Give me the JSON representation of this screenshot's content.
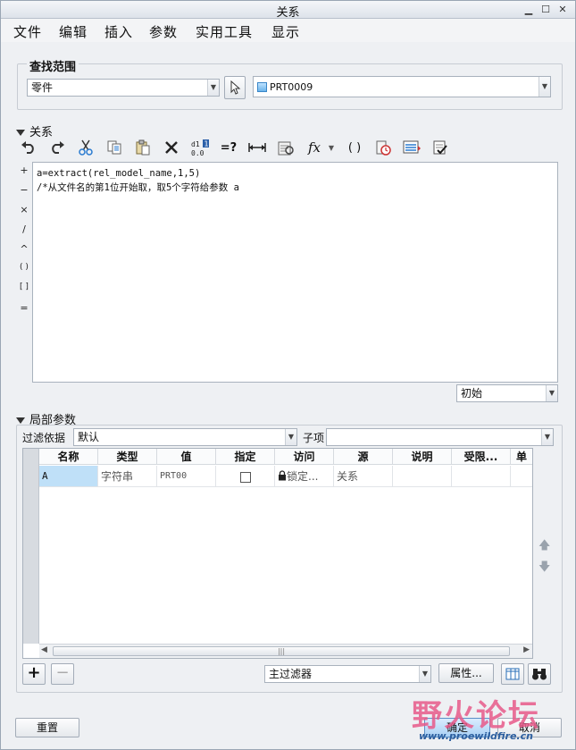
{
  "window": {
    "title": "关系"
  },
  "menu": [
    "文件",
    "编辑",
    "插入",
    "参数",
    "实用工具",
    "显示"
  ],
  "search_scope": {
    "legend": "查找范围",
    "scope_value": "零件",
    "model_value": "PRT0009"
  },
  "relations": {
    "header": "关系",
    "toolbar_icons": [
      "undo-icon",
      "redo-icon",
      "cut-icon",
      "copy-icon",
      "paste-icon",
      "delete-icon",
      "evaluate-icon",
      "equals-question-icon",
      "dimension-icon",
      "parameter-icon",
      "function-icon",
      "brackets-icon",
      "verify-icon",
      "sort-icon",
      "check-icon"
    ],
    "function_label": "fx",
    "brackets_label": "( )",
    "equals_question_label": "=?",
    "operators": [
      "+",
      "−",
      "×",
      "/",
      "^",
      "( )",
      "[ ]",
      "="
    ],
    "lines": [
      "a=extract(rel_model_name,1,5)",
      "/*从文件名的第1位开始取，取5个字符给参数 a"
    ],
    "units_value": "初始"
  },
  "local_params": {
    "header": "局部参数",
    "filter_label": "过滤依据",
    "filter_value": "默认",
    "sub_label": "子项",
    "sub_value": "",
    "columns": [
      "名称",
      "类型",
      "值",
      "指定",
      "访问",
      "源",
      "说明",
      "受限...",
      "单"
    ],
    "rows": [
      {
        "name": "A",
        "type": "字符串",
        "value": "PRT00",
        "designated": false,
        "access": "锁定...",
        "source": "关系",
        "desc": "",
        "restricted": ""
      }
    ],
    "scroll_marker": "|||",
    "main_filter": "主过滤器",
    "properties_label": "属性..."
  },
  "buttons": {
    "reset": "重置",
    "ok": "确定",
    "cancel": "取消"
  },
  "watermark": {
    "text": "野火论坛",
    "url": "www.proewildfire.cn"
  }
}
